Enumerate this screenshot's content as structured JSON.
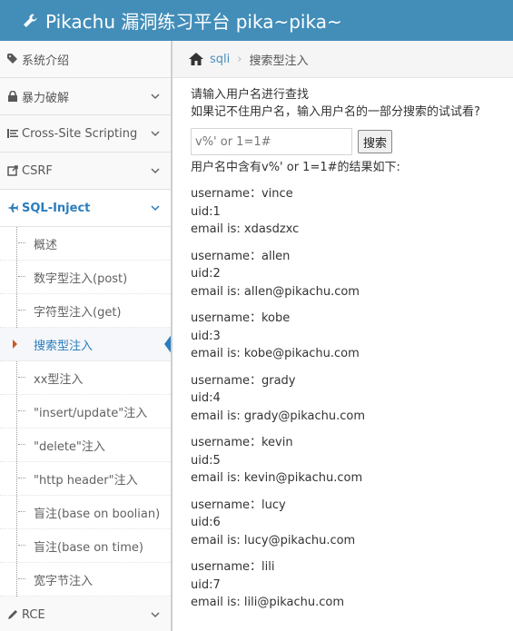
{
  "header": {
    "title": "Pikachu 漏洞练习平台 pika~pika~"
  },
  "sidebar": {
    "items": [
      {
        "label": "系统介绍",
        "icon": "tag-icon"
      },
      {
        "label": "暴力破解",
        "icon": "lock-icon"
      },
      {
        "label": "Cross-Site Scripting",
        "icon": "list-icon"
      },
      {
        "label": "CSRF",
        "icon": "share-icon"
      },
      {
        "label": "SQL-Inject",
        "icon": "plane-icon"
      }
    ],
    "sub_items": [
      "概述",
      "数字型注入(post)",
      "字符型注入(get)",
      "搜索型注入",
      "xx型注入",
      "\"insert/update\"注入",
      "\"delete\"注入",
      "\"http header\"注入",
      "盲注(base on boolian)",
      "盲注(base on time)",
      "宽字节注入"
    ],
    "rce": {
      "label": "RCE",
      "icon": "pencil-icon"
    }
  },
  "breadcrumb": {
    "link": "sqli",
    "current": "搜索型注入"
  },
  "main": {
    "hint1": "请输入用户名进行查找",
    "hint2": "如果记不住用户名，输入用户名的一部分搜索的试试看?",
    "search_value": "v%' or 1=1#",
    "search_button": "搜索",
    "result_title": "用户名中含有v%' or 1=1#的结果如下:",
    "records": [
      {
        "username": "username：vince",
        "uid": "uid:1",
        "email": "email is: xdasdzxc"
      },
      {
        "username": "username：allen",
        "uid": "uid:2",
        "email": "email is: allen@pikachu.com"
      },
      {
        "username": "username：kobe",
        "uid": "uid:3",
        "email": "email is: kobe@pikachu.com"
      },
      {
        "username": "username：grady",
        "uid": "uid:4",
        "email": "email is: grady@pikachu.com"
      },
      {
        "username": "username：kevin",
        "uid": "uid:5",
        "email": "email is: kevin@pikachu.com"
      },
      {
        "username": "username：lucy",
        "uid": "uid:6",
        "email": "email is: lucy@pikachu.com"
      },
      {
        "username": "username：lili",
        "uid": "uid:7",
        "email": "email is: lili@pikachu.com"
      }
    ]
  },
  "colors": {
    "header_bg": "#438eb9",
    "accent": "#2b7dbc",
    "active_caret": "#c85a25"
  }
}
